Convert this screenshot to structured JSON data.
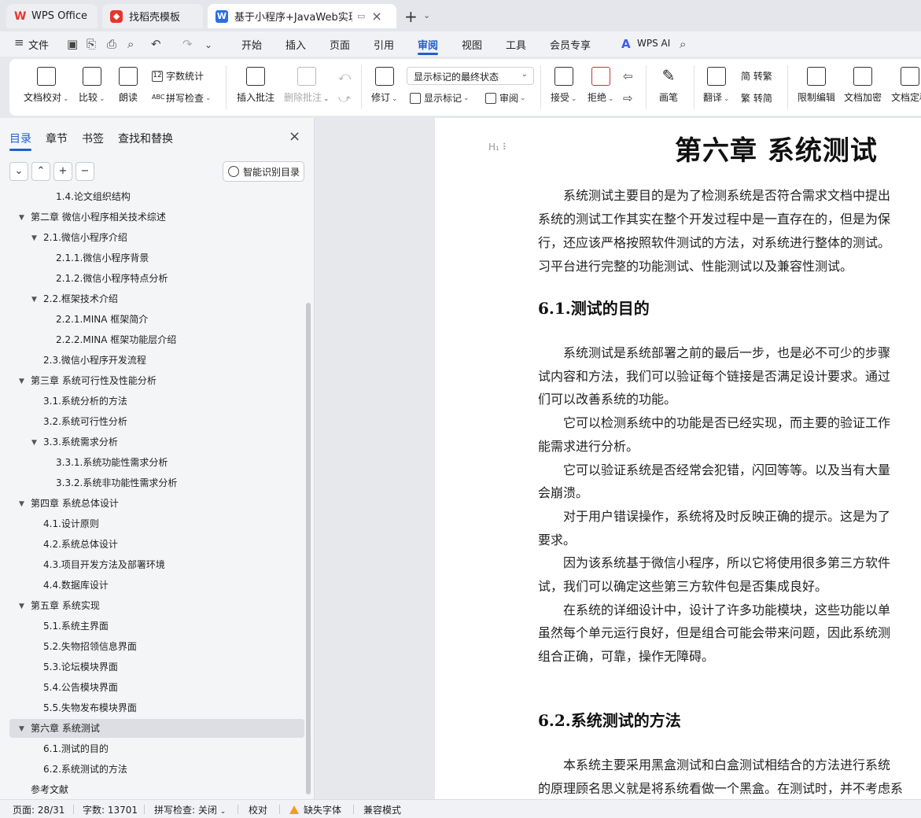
{
  "titlebar": {
    "tabs": [
      {
        "label": "WPS Office",
        "icon": "wps-logo-icon"
      },
      {
        "label": "找稻壳模板",
        "icon": "docer-logo-icon"
      },
      {
        "label": "基于小程序+JavaWeb实现的",
        "icon": "writer-logo-icon"
      }
    ],
    "new_tab": "+"
  },
  "menubar": {
    "file": "文件",
    "items": [
      "开始",
      "插入",
      "页面",
      "引用",
      "审阅",
      "视图",
      "工具",
      "会员专享"
    ],
    "active": "审阅",
    "ai": "WPS AI"
  },
  "ribbon": {
    "doc_check": "文档校对",
    "compare": "比较",
    "read_aloud": "朗读",
    "word_count": "字数统计",
    "spell_check": "拼写检查",
    "insert_comment": "插入批注",
    "delete_comment": "删除批注",
    "track": "修订",
    "markup_state": "显示标记的最终状态",
    "show_markup": "显示标记",
    "review_pane": "审阅",
    "accept": "接受",
    "reject": "拒绝",
    "pen": "画笔",
    "translate": "翻译",
    "to_traditional": "简 转繁",
    "to_simplified": "繁 转简",
    "restrict_edit": "限制编辑",
    "encrypt": "文档加密",
    "finalize": "文档定稿"
  },
  "leftpanel": {
    "tabs": [
      "目录",
      "章节",
      "书签",
      "查找和替换"
    ],
    "active_tab": "目录",
    "smart_toc": "智能识别目录",
    "toc": [
      {
        "label": "1.4.论文组织结构",
        "level": 3,
        "caret": false
      },
      {
        "label": "第二章  微信小程序相关技术综述",
        "level": 1,
        "caret": true
      },
      {
        "label": "2.1.微信小程序介绍",
        "level": 2,
        "caret": true
      },
      {
        "label": "2.1.1.微信小程序背景",
        "level": 3,
        "caret": false
      },
      {
        "label": "2.1.2.微信小程序特点分析",
        "level": 3,
        "caret": false
      },
      {
        "label": "2.2.框架技术介绍",
        "level": 2,
        "caret": true
      },
      {
        "label": "2.2.1.MINA 框架简介",
        "level": 3,
        "caret": false
      },
      {
        "label": "2.2.2.MINA 框架功能层介绍",
        "level": 3,
        "caret": false
      },
      {
        "label": "2.3.微信小程序开发流程",
        "level": 2,
        "caret": false
      },
      {
        "label": "第三章  系统可行性及性能分析",
        "level": 1,
        "caret": true
      },
      {
        "label": "3.1.系统分析的方法",
        "level": 2,
        "caret": false
      },
      {
        "label": "3.2.系统可行性分析",
        "level": 2,
        "caret": false
      },
      {
        "label": "3.3.系统需求分析",
        "level": 2,
        "caret": true
      },
      {
        "label": "3.3.1.系统功能性需求分析",
        "level": 3,
        "caret": false
      },
      {
        "label": "3.3.2.系统非功能性需求分析",
        "level": 3,
        "caret": false
      },
      {
        "label": "第四章  系统总体设计",
        "level": 1,
        "caret": true
      },
      {
        "label": "4.1.设计原则",
        "level": 2,
        "caret": false
      },
      {
        "label": "4.2.系统总体设计",
        "level": 2,
        "caret": false
      },
      {
        "label": "4.3.项目开发方法及部署环境",
        "level": 2,
        "caret": false
      },
      {
        "label": "4.4.数据库设计",
        "level": 2,
        "caret": false
      },
      {
        "label": "第五章  系统实现",
        "level": 1,
        "caret": true
      },
      {
        "label": "5.1.系统主界面",
        "level": 2,
        "caret": false
      },
      {
        "label": "5.2.失物招领信息界面",
        "level": 2,
        "caret": false
      },
      {
        "label": "5.3.论坛模块界面",
        "level": 2,
        "caret": false
      },
      {
        "label": "5.4.公告模块界面",
        "level": 2,
        "caret": false
      },
      {
        "label": "5.5.失物发布模块界面",
        "level": 2,
        "caret": false
      },
      {
        "label": "第六章  系统测试",
        "level": 1,
        "caret": true,
        "selected": true
      },
      {
        "label": "6.1.测试的目的",
        "level": 2,
        "caret": false
      },
      {
        "label": "6.2.系统测试的方法",
        "level": 2,
        "caret": false
      },
      {
        "label": "参考文献",
        "level": 1,
        "caret": false
      }
    ]
  },
  "document": {
    "heading_handle": "H₁ ⠇",
    "title": "第六章  系统测试",
    "intro": [
      "　　系统测试主要目的是为了检测系统是否符合需求文档中提出",
      "系统的测试工作其实在整个开发过程中是一直存在的，但是为保",
      "行，还应该严格按照软件测试的方法，对系统进行整体的测试。",
      "习平台进行完整的功能测试、性能测试以及兼容性测试。"
    ],
    "section1_title": "6.1.测试的目的",
    "section1": [
      "　　系统测试是系统部署之前的最后一步，也是必不可少的步骤",
      "试内容和方法，我们可以验证每个链接是否满足设计要求。通过",
      "们可以改善系统的功能。",
      "　　它可以检测系统中的功能是否已经实现，而主要的验证工作",
      "能需求进行分析。",
      "　　它可以验证系统是否经常会犯错，闪回等等。以及当有大量",
      "会崩溃。",
      "　　对于用户错误操作，系统将及时反映正确的提示。这是为了",
      "要求。",
      "　　因为该系统基于微信小程序，所以它将使用很多第三方软件",
      "试，我们可以确定这些第三方软件包是否集成良好。",
      "　　在系统的详细设计中，设计了许多功能模块，这些功能以单",
      "虽然每个单元运行良好，但是组合可能会带来问题，因此系统测",
      "组合正确，可靠，操作无障碍。"
    ],
    "section2_title": "6.2.系统测试的方法",
    "section2": [
      "　　本系统主要采用黑盒测试和白盒测试相结合的方法进行系统",
      "的原理顾名思义就是将系统看做一个黑盒。在测试时，并不考虑系"
    ]
  },
  "statusbar": {
    "page": "页面: 28/31",
    "words": "字数: 13701",
    "spell": "拼写检查: 关闭",
    "proof": "校对",
    "missing_font": "缺失字体",
    "compat": "兼容模式"
  }
}
